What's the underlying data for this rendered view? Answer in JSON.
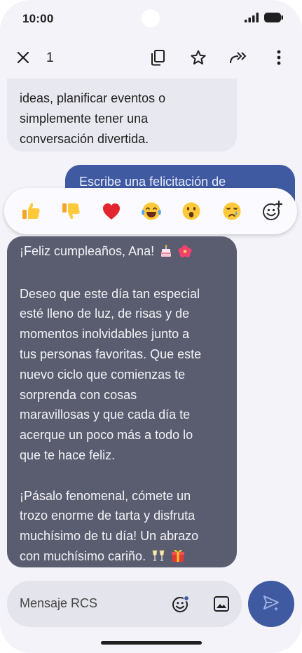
{
  "status_bar": {
    "time": "10:00",
    "icons": [
      "signal-icon",
      "battery-icon"
    ]
  },
  "app_bar": {
    "selected_count": "1",
    "actions": [
      "close-icon",
      "copy-icon",
      "star-icon",
      "forward-icon",
      "more-vert-icon"
    ]
  },
  "messages": {
    "incoming_top_lines": [
      "ideas, planificar eventos o",
      "simplemente tener una",
      "conversación divertida."
    ],
    "outgoing_text": "Escribe una felicitación de",
    "selected": {
      "greeting": "¡Feliz cumpleaños, Ana!",
      "greeting_emojis": [
        "birthday-cake",
        "hibiscus"
      ],
      "para1_lines": [
        "Deseo que este día tan especial",
        "esté lleno de luz, de risas y de",
        "momentos inolvidables junto a",
        "tus personas favoritas. Que este",
        "nuevo ciclo que comienzas te",
        "sorprenda con cosas",
        "maravillosas y que cada día te",
        "acerque un poco más a todo lo",
        "que te hace feliz."
      ],
      "para2_lines": [
        "¡Pásalo fenomenal, cómete un",
        "trozo enorme de tarta y disfruta",
        "muchísimo de tu día! Un abrazo",
        "con muchísimo cariño."
      ],
      "closing_emojis": [
        "clinking-glasses",
        "gift"
      ]
    }
  },
  "reactions": [
    "thumbs-up",
    "thumbs-down",
    "red-heart",
    "tears-of-joy",
    "surprised-face",
    "crying-face",
    "add-reaction-icon"
  ],
  "composer": {
    "placeholder": "Mensaje RCS",
    "icons": [
      "emoji-icon",
      "gallery-icon"
    ],
    "send_icon": "send-icon"
  },
  "colors": {
    "background": "#f3f3f9",
    "incoming_bubble": "#e8e8f0",
    "outgoing_bubble": "#3f5aa0",
    "selected_bubble": "#5a5d6f",
    "send_button": "#3f5aa0"
  }
}
